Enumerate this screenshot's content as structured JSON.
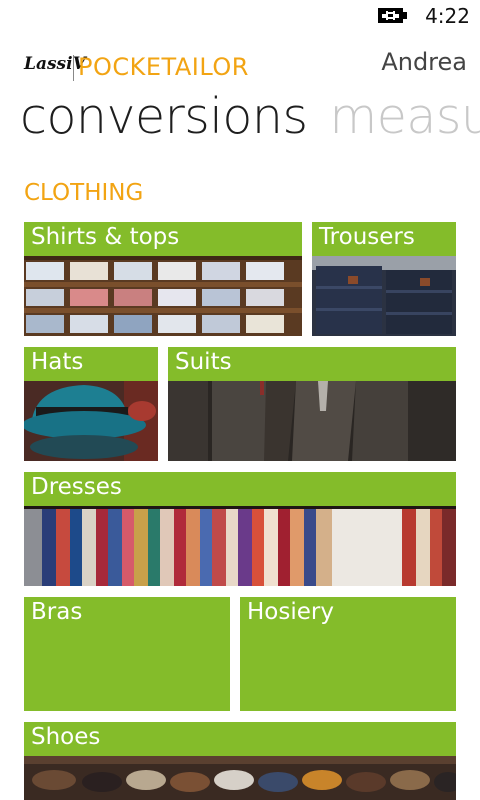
{
  "status": {
    "time": "4:22",
    "battery_icon": "battery-charging-icon"
  },
  "header": {
    "logo": "LassiV",
    "app_name": "POCKETAILOR",
    "user": "Andrea"
  },
  "pivot": {
    "active": "conversions",
    "next": "measu"
  },
  "section": {
    "title": "CLOTHING"
  },
  "tiles": [
    {
      "label": "Shirts & tops",
      "photo": "shirts-photo"
    },
    {
      "label": "Trousers",
      "photo": "trousers-photo"
    },
    {
      "label": "Hats",
      "photo": "hats-photo"
    },
    {
      "label": "Suits",
      "photo": "suits-photo"
    },
    {
      "label": "Dresses",
      "photo": "dresses-photo"
    },
    {
      "label": "Bras"
    },
    {
      "label": "Hosiery"
    },
    {
      "label": "Shoes",
      "photo": "shoes-photo"
    }
  ],
  "colors": {
    "accent": "#f2a413",
    "tile": "#84bc2a",
    "pivot_active": "#1e1e1e",
    "pivot_inactive": "#c8c8c8"
  }
}
